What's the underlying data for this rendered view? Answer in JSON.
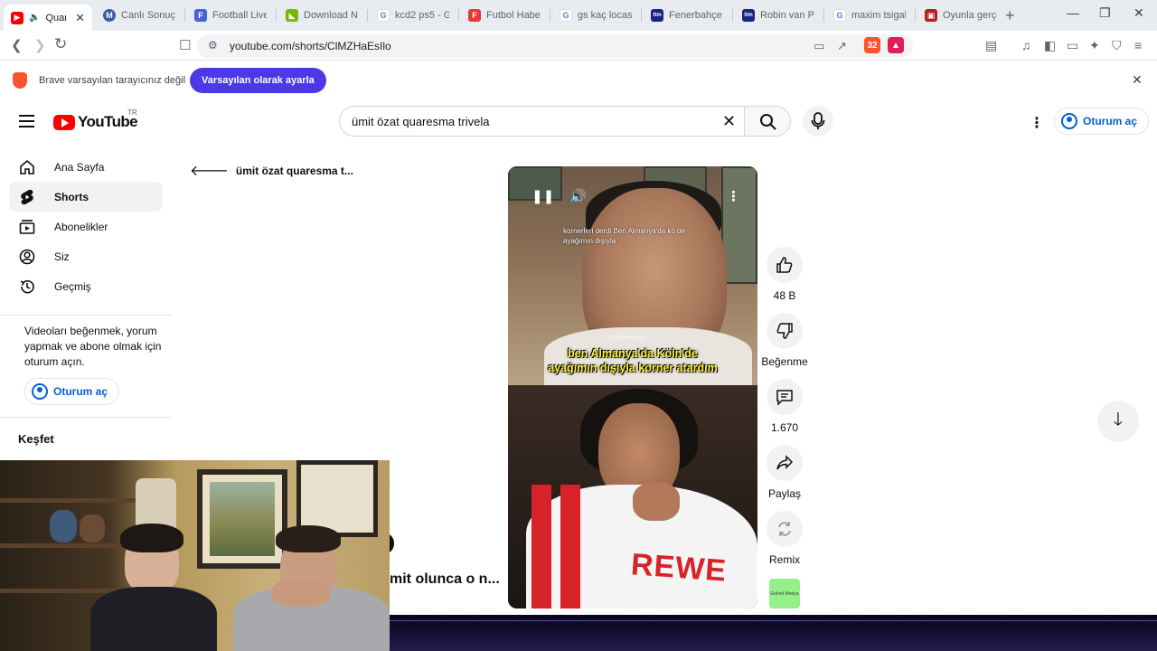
{
  "browser": {
    "tabs": [
      {
        "label": "Quare",
        "favicon_color": "#ff0000",
        "active": true
      },
      {
        "label": "Canlı Sonuçla",
        "favicon_color": "#3b5ba8",
        "active": false
      },
      {
        "label": "Football Live",
        "favicon_color": "#4a62d8",
        "active": false
      },
      {
        "label": "Download Nv",
        "favicon_color": "#76b900",
        "active": false
      },
      {
        "label": "kcd2 ps5 - G",
        "favicon_color": "#4285f4",
        "active": false
      },
      {
        "label": "Futbol Haber",
        "favicon_color": "#e53935",
        "active": false
      },
      {
        "label": "gs kaç locası",
        "favicon_color": "#4285f4",
        "active": false
      },
      {
        "label": "Fenerbahçe S",
        "favicon_color": "#1a237e",
        "active": false
      },
      {
        "label": "Robin van Pe",
        "favicon_color": "#1a237e",
        "active": false
      },
      {
        "label": "maxim tsigali",
        "favicon_color": "#4285f4",
        "active": false
      },
      {
        "label": "Oyunla gerçe",
        "favicon_color": "#b71c1c",
        "active": false
      }
    ],
    "url": "youtube.com/shorts/ClMZHaEsIlo",
    "shield_count": "32",
    "rewards_count": "1"
  },
  "infobar": {
    "message": "Brave varsayılan tarayıcınız değil",
    "cta": "Varsayılan olarak ayarla"
  },
  "header": {
    "logo_text": "YouTube",
    "country_code": "TR",
    "search_query": "ümit özat quaresma trivela",
    "signin_label": "Oturum aç"
  },
  "sidebar": {
    "items": [
      {
        "label": "Ana Sayfa",
        "icon": "home-icon"
      },
      {
        "label": "Shorts",
        "icon": "shorts-icon"
      },
      {
        "label": "Abonelikler",
        "icon": "subscriptions-icon"
      },
      {
        "label": "Siz",
        "icon": "you-icon"
      },
      {
        "label": "Geçmiş",
        "icon": "history-icon"
      }
    ],
    "signin_message": "Videoları beğenmek, yorum yapmak ve abone olmak için oturum açın.",
    "signin_label": "Oturum aç",
    "explore_title": "Keşfet"
  },
  "back_link": "ümit özat quaresma t...",
  "short": {
    "caption_small": "kornerleri derdi Ben Almanya'da kö de ayağımın dışıyla",
    "caption_big_line1": "ben Almanya'da Köln'de",
    "caption_big_line2": "ayağımın dışıyla korner atardım",
    "watermark": "@golnetmedya",
    "jersey_text": "REWE",
    "channel_thumb_text": "Golnet Medya"
  },
  "actions": {
    "like_count": "48 B",
    "dislike_label": "Beğenme",
    "comment_count": "1.670",
    "share_label": "Paylaş",
    "remix_label": "Remix"
  },
  "overlay": {
    "partial_title": "mit olunca o n..."
  }
}
